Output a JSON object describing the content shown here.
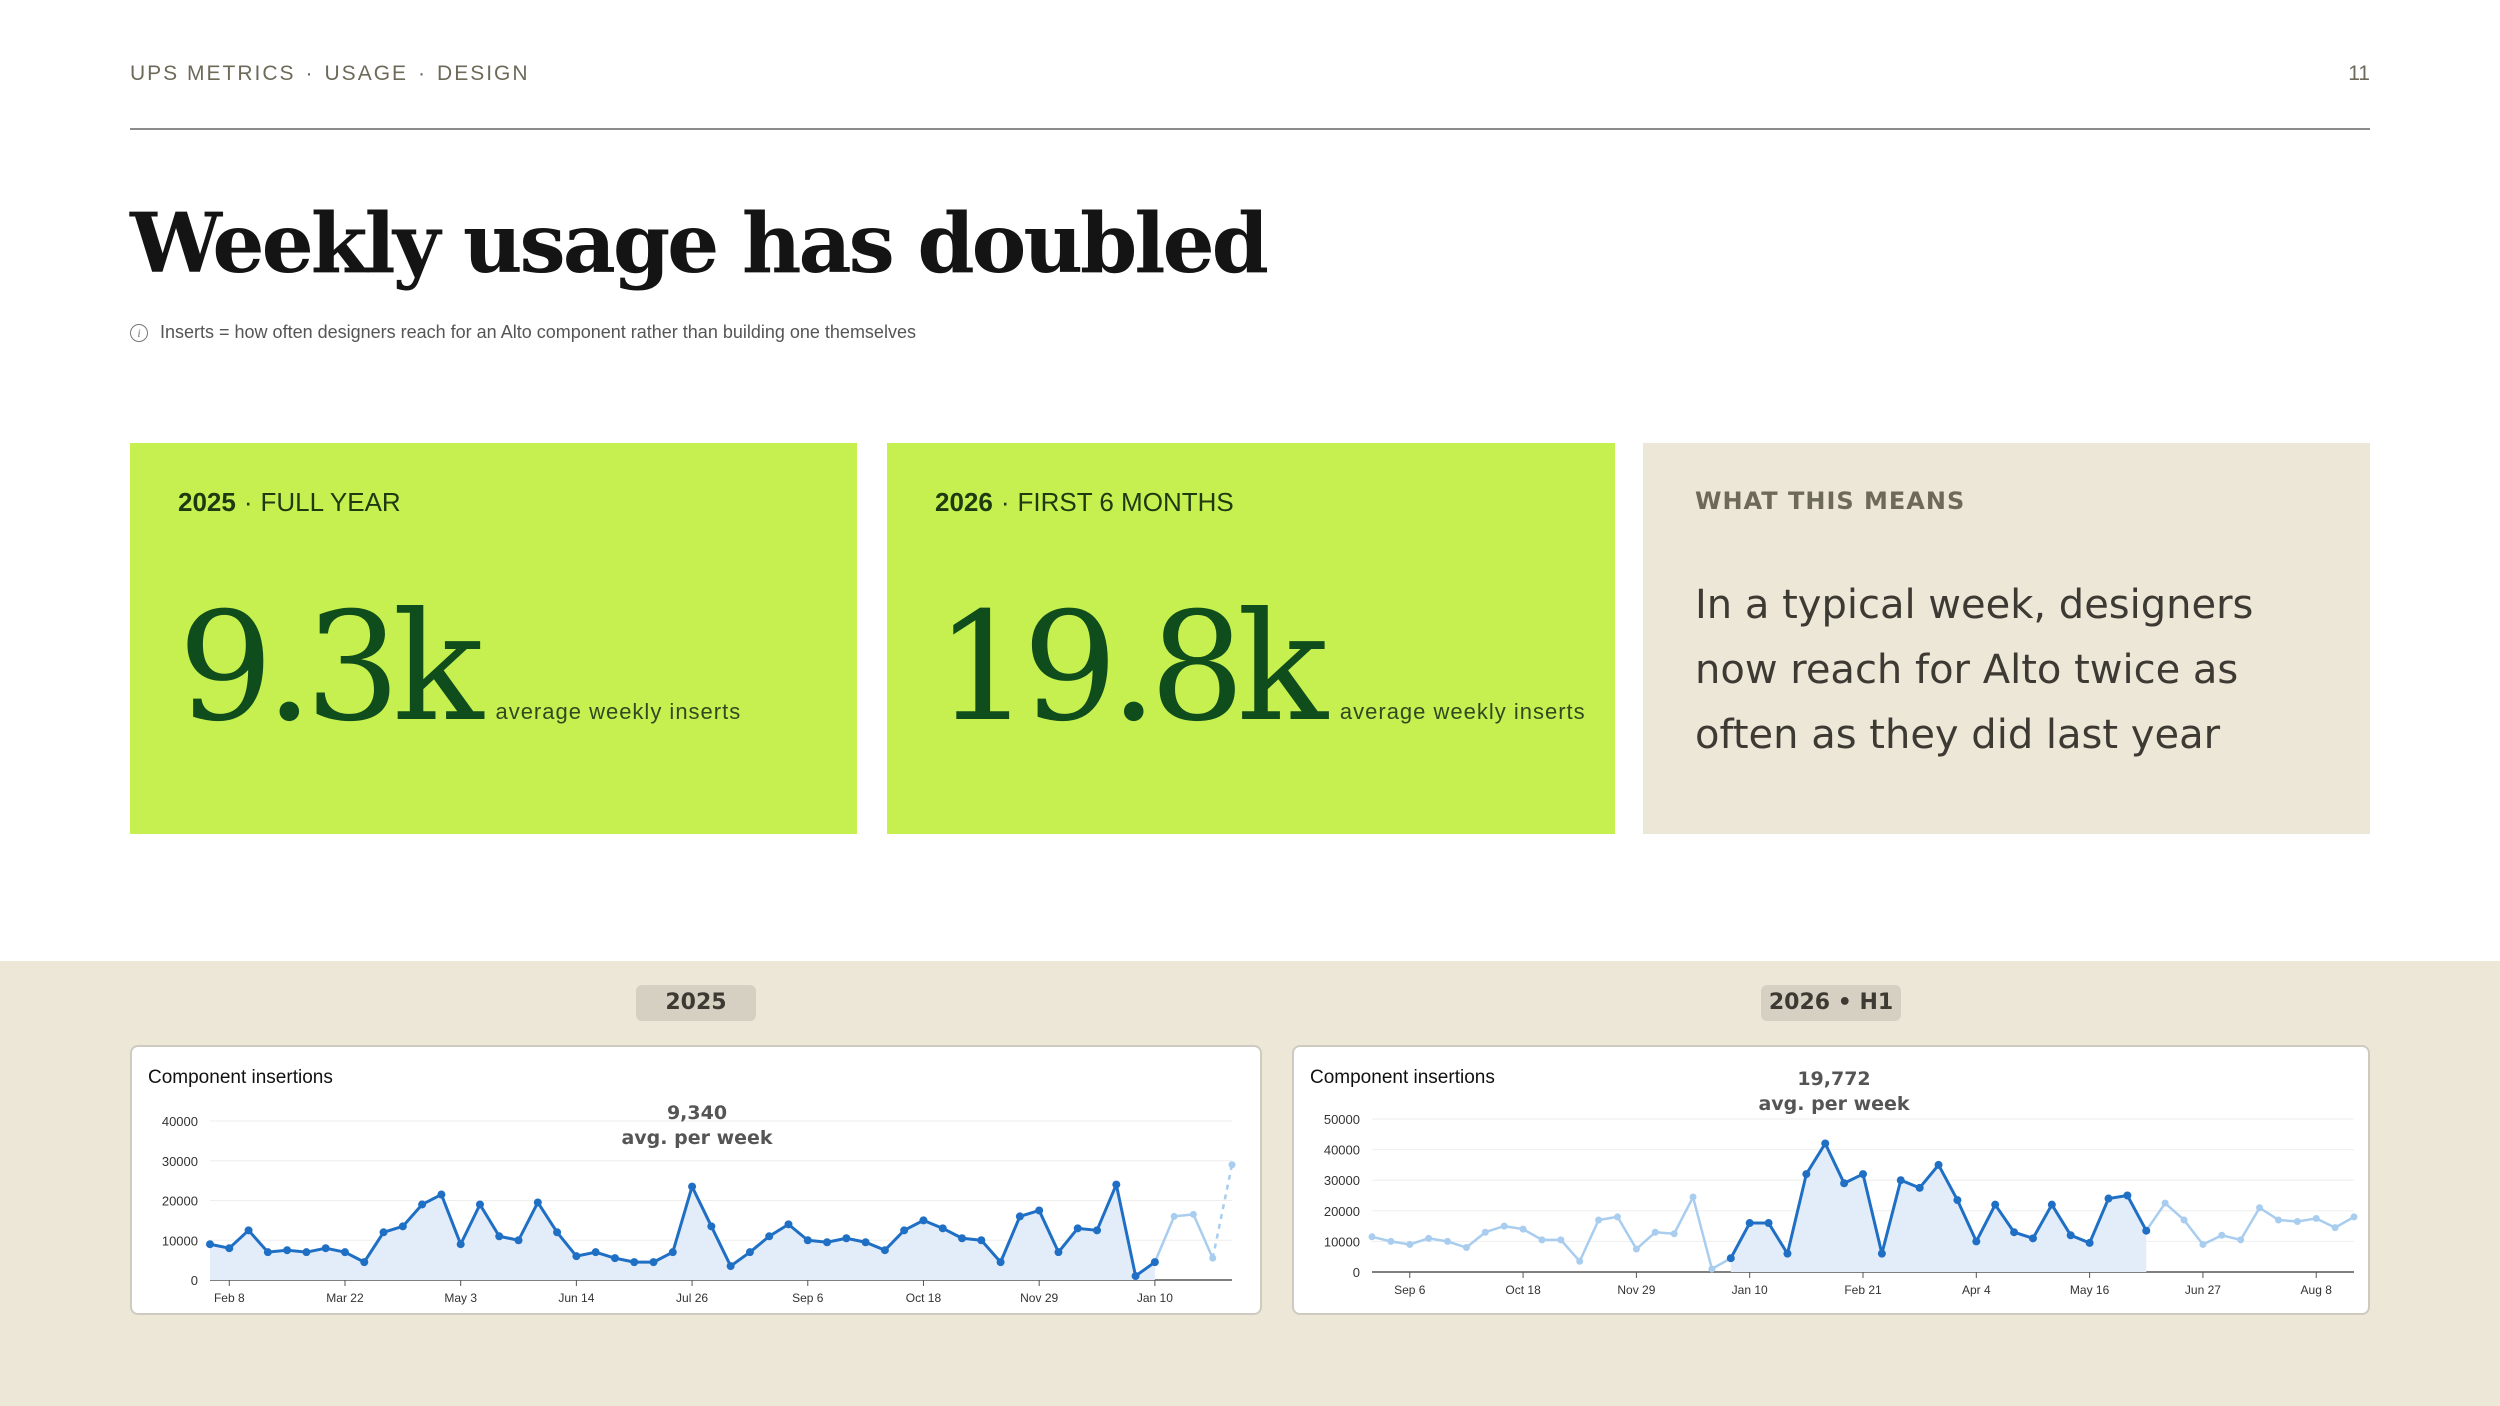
{
  "header": {
    "breadcrumb": [
      "UPS METRICS",
      "USAGE",
      "DESIGN"
    ],
    "separator": "·",
    "page_number": "11"
  },
  "title": "Weekly usage has doubled",
  "note": {
    "icon": "info-icon",
    "text": "Inserts = how often designers reach for an Alto component rather than building one themselves"
  },
  "cards": [
    {
      "year": "2025",
      "period": "FULL YEAR",
      "value": "9.3k",
      "unit": "average weekly inserts"
    },
    {
      "year": "2026",
      "period": "FIRST 6 MONTHS",
      "value": "19.8k",
      "unit": "average weekly inserts"
    }
  ],
  "insight": {
    "label": "WHAT THIS MEANS",
    "text": "In a typical week, designers now reach for Alto twice as often as they did last year"
  },
  "pills": {
    "left": "2025",
    "right": "2026 • H1"
  },
  "colors": {
    "card_green": "#c6f04f",
    "number_green": "#0f4d1c",
    "beige": "#ede7d8",
    "line_blue": "#1f6fc5",
    "line_light_blue": "#a9cdef",
    "area_fill": "#e3edf9"
  },
  "chart_data": [
    {
      "type": "line",
      "title": "Component insertions",
      "annotation": {
        "value": "9,340",
        "label": "avg. per week"
      },
      "ylim": [
        0,
        40000
      ],
      "y_ticks": [
        "0",
        "10000",
        "20000",
        "30000",
        "40000"
      ],
      "x_tick_labels": [
        "Feb 8",
        "Mar 22",
        "May 3",
        "Jun 14",
        "Jul 26",
        "Sep 6",
        "Oct 18",
        "Nov 29",
        "Jan 10"
      ],
      "x_tick_index": [
        1,
        7,
        13,
        19,
        25,
        31,
        37,
        43,
        49
      ],
      "highlight_range": [
        0,
        49
      ],
      "values": [
        9000,
        8000,
        12500,
        7000,
        7500,
        7000,
        8000,
        7000,
        4500,
        12000,
        13500,
        19000,
        21500,
        9000,
        19000,
        11000,
        10000,
        19500,
        12000,
        6000,
        7000,
        5500,
        4500,
        4500,
        7000,
        23500,
        13500,
        3500,
        7000,
        11000,
        14000,
        10000,
        9500,
        10500,
        9500,
        7500,
        12500,
        15000,
        13000,
        10500,
        10000,
        4500,
        16000,
        17500,
        7000,
        13000,
        12500,
        24000,
        1000,
        4500,
        16000,
        16500,
        5500,
        29000
      ],
      "grid": true
    },
    {
      "type": "line",
      "title": "Component insertions",
      "annotation": {
        "value": "19,772",
        "label": "avg. per week"
      },
      "ylim": [
        0,
        50000
      ],
      "y_ticks": [
        "0",
        "10000",
        "20000",
        "30000",
        "40000",
        "50000"
      ],
      "x_tick_labels": [
        "Sep 6",
        "Oct 18",
        "Nov 29",
        "Jan 10",
        "Feb 21",
        "Apr 4",
        "May 16",
        "Jun 27",
        "Aug 8"
      ],
      "x_tick_index": [
        2,
        8,
        14,
        20,
        26,
        32,
        38,
        44,
        50
      ],
      "highlight_range": [
        19,
        41
      ],
      "values": [
        11500,
        10000,
        9000,
        11000,
        10000,
        8000,
        13000,
        15000,
        14000,
        10500,
        10500,
        3500,
        17000,
        18000,
        7500,
        13000,
        12500,
        24500,
        1000,
        4500,
        16000,
        16000,
        6000,
        32000,
        42000,
        29000,
        32000,
        6000,
        30000,
        27500,
        35000,
        23500,
        10000,
        22000,
        13000,
        11000,
        22000,
        12000,
        9500,
        24000,
        25000,
        13500,
        22500,
        17000,
        9000,
        12000,
        10500,
        21000,
        17000,
        16500,
        17500,
        14500,
        18000
      ],
      "grid": true
    }
  ]
}
